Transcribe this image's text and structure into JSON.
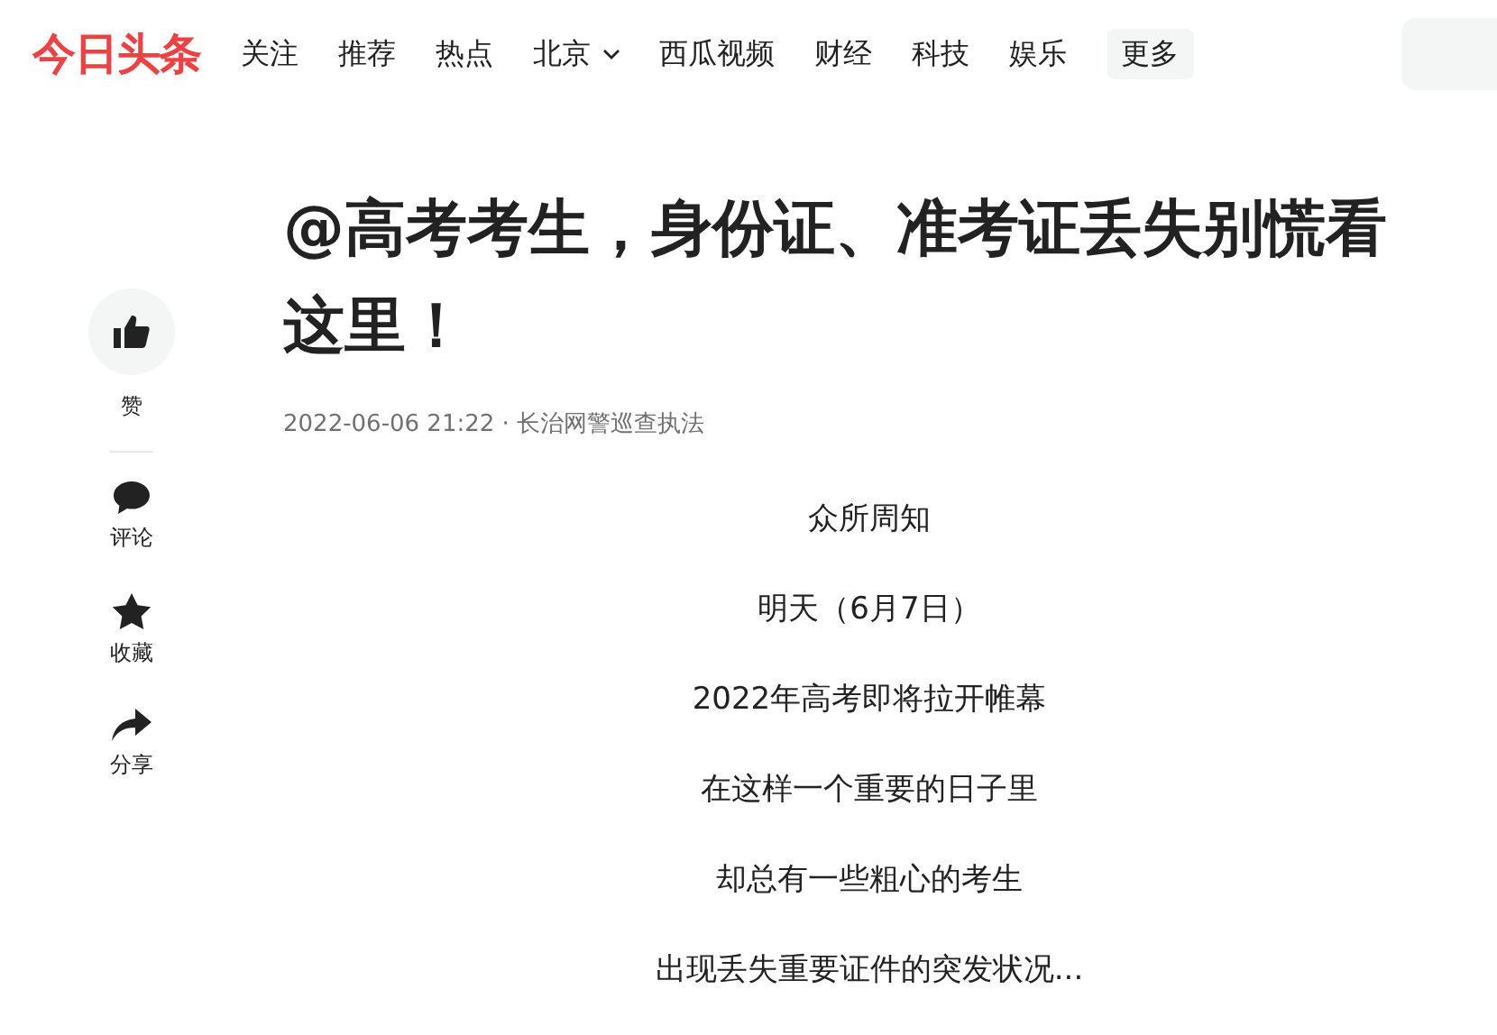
{
  "logo": "今日头条",
  "nav": [
    {
      "label": "关注",
      "kind": "link"
    },
    {
      "label": "推荐",
      "kind": "link"
    },
    {
      "label": "热点",
      "kind": "link"
    },
    {
      "label": "北京",
      "kind": "dropdown"
    },
    {
      "label": "西瓜视频",
      "kind": "link"
    },
    {
      "label": "财经",
      "kind": "link"
    },
    {
      "label": "科技",
      "kind": "link"
    },
    {
      "label": "娱乐",
      "kind": "link"
    },
    {
      "label": "更多",
      "kind": "button"
    }
  ],
  "actions": [
    {
      "label": "赞",
      "kind": "like"
    },
    {
      "label": "评论",
      "kind": "comment"
    },
    {
      "label": "收藏",
      "kind": "favorite"
    },
    {
      "label": "分享",
      "kind": "share"
    }
  ],
  "article": {
    "title": "@高考考生，身份证、准考证丢失别慌看这里！",
    "meta": "2022-06-06 21:22 · 长治网警巡查执法",
    "paragraphs": [
      "众所周知",
      "明天（6月7日）",
      "2022年高考即将拉开帷幕",
      "在这样一个重要的日子里",
      "却总有一些粗心的考生",
      "出现丢失重要证件的突发状况..."
    ]
  }
}
